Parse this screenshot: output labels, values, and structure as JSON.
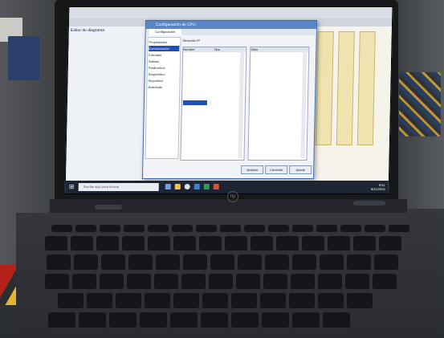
{
  "photo": {
    "subject": "Laptop on a workbench showing a configuration dialog"
  },
  "app": {
    "panel_title": "Editor de diagrama",
    "dialog_title": "Configuración de CPU",
    "tab_active": "Configuración",
    "field_label": "Dirección IP",
    "grid_a_headers": [
      "Nombre",
      "Tipo"
    ],
    "grid_b_headers": [
      "Valor"
    ],
    "nav_items": [
      "Propiedades",
      "Comunicación",
      "Entradas",
      "Salidas",
      "Parámetros",
      "Diagnóstico",
      "Seguridad",
      "Avanzado"
    ],
    "buttons": [
      "Aceptar",
      "Cancelar",
      "Ayuda"
    ]
  },
  "taskbar": {
    "search_placeholder": "Escribe aquí para buscar",
    "time": "9:51",
    "date": "8/11/2024"
  },
  "brand": "hp",
  "colors": {
    "selection": "#1f4fb8",
    "taskbar": "#1d2433",
    "blocks": "#e6a93a"
  }
}
